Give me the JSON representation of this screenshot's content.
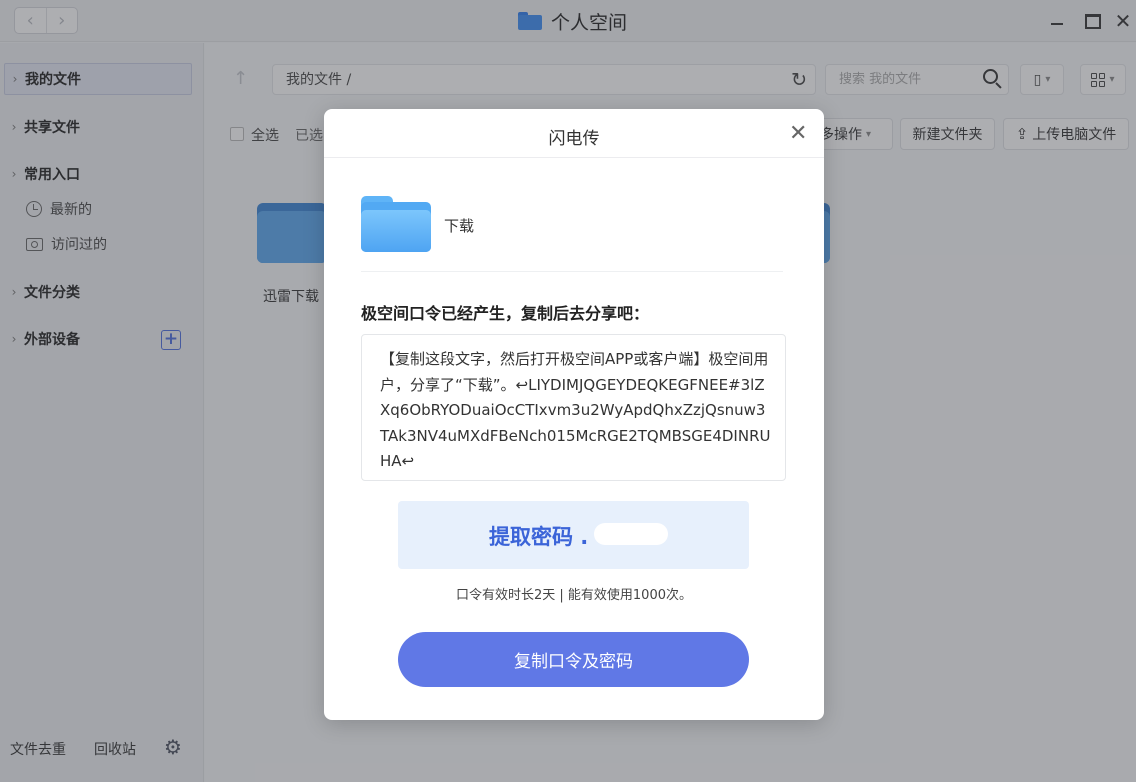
{
  "window": {
    "title": "个人空间",
    "close_glyph": "✕",
    "back_glyph": "‹",
    "forward_glyph": "›"
  },
  "sidebar": {
    "items": [
      {
        "label": "我的文件",
        "active": true
      },
      {
        "label": "共享文件"
      },
      {
        "label": "常用入口"
      },
      {
        "label": "文件分类"
      },
      {
        "label": "外部设备"
      }
    ],
    "sub_items": [
      {
        "label": "最新的",
        "icon": "clock-icon"
      },
      {
        "label": "访问过的",
        "icon": "camera-icon"
      }
    ],
    "bottom": {
      "dedupe": "文件去重",
      "recycle": "回收站"
    }
  },
  "main": {
    "path": "我的文件 /",
    "search_placeholder": "搜索 我的文件",
    "select_all": "全选",
    "selected": "已选",
    "more_ops": "多操作",
    "new_folder": "新建文件夹",
    "upload": "上传电脑文件",
    "folders": [
      {
        "label": "迅雷下载"
      }
    ]
  },
  "dialog": {
    "title": "闪电传",
    "file_name": "下载",
    "heading": "极空间口令已经产生，复制后去分享吧：",
    "share_text": "【复制这段文字，然后打开极空间APP或客户端】极空间用户，分享了“下载”。↩LIYDIMJQGEYDEQKEGFNEE#3lZXq6ObRYODuaiOcCTIxvm3u2WyApdQhxZzjQsnuw3TAk3NV4uMXdFBeNch015McRGE2TQMBSGE4DINRUHA↩",
    "password_label": "提取密码 .",
    "validity": "口令有效时长2天 | 能有效使用1000次。",
    "copy_button": "复制口令及密码"
  },
  "colors": {
    "accent": "#6078e6",
    "password_text": "#3b64d8",
    "password_bg": "#e7f0fc",
    "folder_blue": "#52a9f3"
  }
}
